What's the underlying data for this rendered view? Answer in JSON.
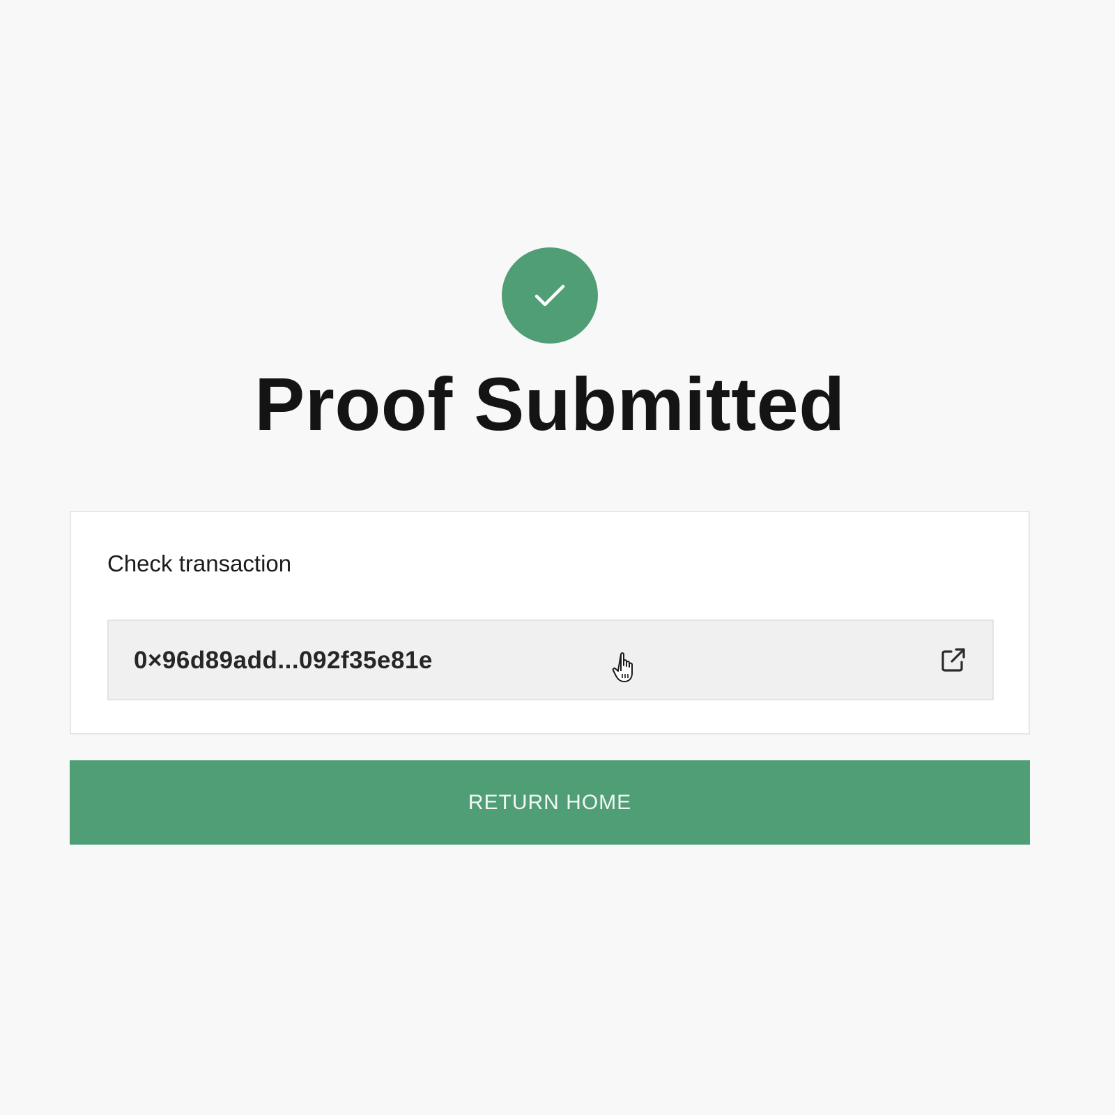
{
  "status": {
    "icon": "check-icon",
    "color": "#4f9e76"
  },
  "title": "Proof Submitted",
  "transaction": {
    "label": "Check transaction",
    "hash": "0×96d89add...092f35e81e",
    "link_icon": "external-link-icon"
  },
  "actions": {
    "return_home": "RETURN HOME"
  },
  "cursor": "pointer-hand-cursor",
  "colors": {
    "accent": "#4f9e76",
    "background": "#f8f8f8",
    "field_bg": "#f0f0f1",
    "title_text": "#141414"
  }
}
